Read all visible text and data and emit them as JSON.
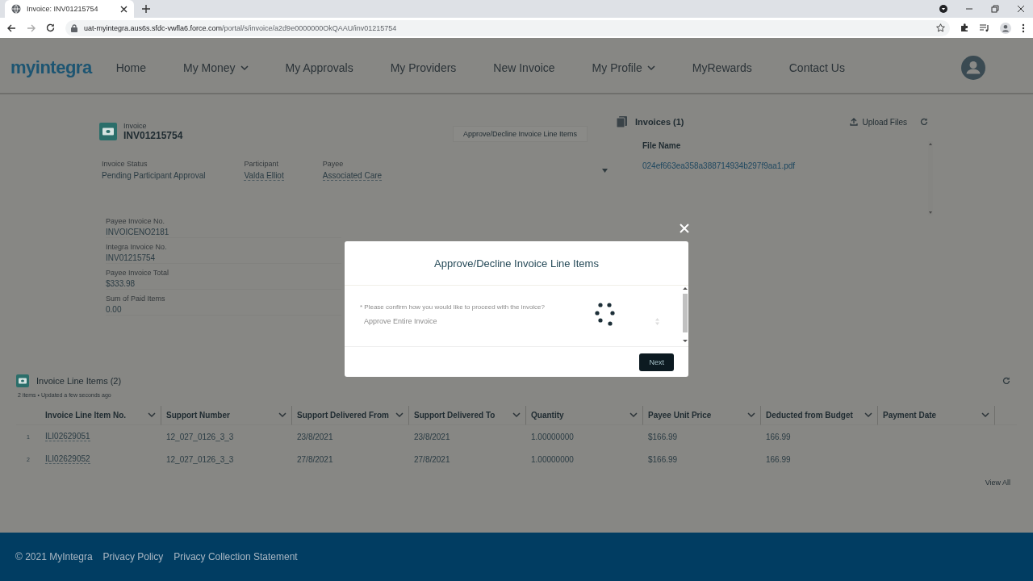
{
  "browser": {
    "tab_title": "Invoice: INV01215754",
    "url_host": "uat-myintegra.aus6s.sfdc-vwfla6.force.com",
    "url_path": "/portal/s/invoice/a2d9e0000000OkQAAU/inv01215754"
  },
  "nav": {
    "logo": "myintegra",
    "items": [
      {
        "label": "Home",
        "dropdown": false
      },
      {
        "label": "My Money",
        "dropdown": true
      },
      {
        "label": "My Approvals",
        "dropdown": false
      },
      {
        "label": "My Providers",
        "dropdown": false
      },
      {
        "label": "New Invoice",
        "dropdown": false
      },
      {
        "label": "My Profile",
        "dropdown": true
      },
      {
        "label": "MyRewards",
        "dropdown": false
      },
      {
        "label": "Contact Us",
        "dropdown": false
      }
    ]
  },
  "invoice": {
    "type_label": "Invoice",
    "number": "INV01215754",
    "action_button": "Approve/Decline Invoice Line Items",
    "fields": [
      {
        "label": "Invoice Status",
        "value": "Pending Participant Approval",
        "link": false
      },
      {
        "label": "Participant",
        "value": "Valda Elliot",
        "link": true
      },
      {
        "label": "Payee",
        "value": "Associated Care",
        "link": true
      }
    ],
    "details": [
      {
        "label": "Payee Invoice No.",
        "value": "INVOICENO2181"
      },
      {
        "label": "Integra Invoice No.",
        "value": "INV01215754"
      },
      {
        "label": "Payee Invoice Total",
        "value": "$333.98"
      },
      {
        "label": "Sum of Paid Items",
        "value": "0.00"
      }
    ]
  },
  "files": {
    "title": "Invoices (1)",
    "upload": "Upload Files",
    "column": "File Name",
    "rows": [
      "024ef663ea358a388714934b297f9aa1.pdf"
    ]
  },
  "line_items": {
    "title": "Invoice Line Items (2)",
    "meta": "2 items • Updated a few seconds ago",
    "columns": [
      "Invoice Line Item No.",
      "Support Number",
      "Support Delivered From",
      "Support Delivered To",
      "Quantity",
      "Payee Unit Price",
      "Deducted from Budget",
      "Payment Date"
    ],
    "rows": [
      {
        "index": "1",
        "cells": [
          "ILI02629051",
          "12_027_0126_3_3",
          "23/8/2021",
          "23/8/2021",
          "1.00000000",
          "$166.99",
          "166.99",
          ""
        ]
      },
      {
        "index": "2",
        "cells": [
          "ILI02629052",
          "12_027_0126_3_3",
          "27/8/2021",
          "27/8/2021",
          "1.00000000",
          "$166.99",
          "166.99",
          ""
        ]
      }
    ],
    "view_all": "View All"
  },
  "modal": {
    "title": "Approve/Decline Invoice Line Items",
    "question": "* Please confirm how you would like to proceed with the invoice?",
    "select_value": "Approve Entire Invoice",
    "next": "Next"
  },
  "footer": {
    "items": [
      "© 2021 MyIntegra",
      "Privacy Policy",
      "Privacy Collection Statement"
    ]
  }
}
